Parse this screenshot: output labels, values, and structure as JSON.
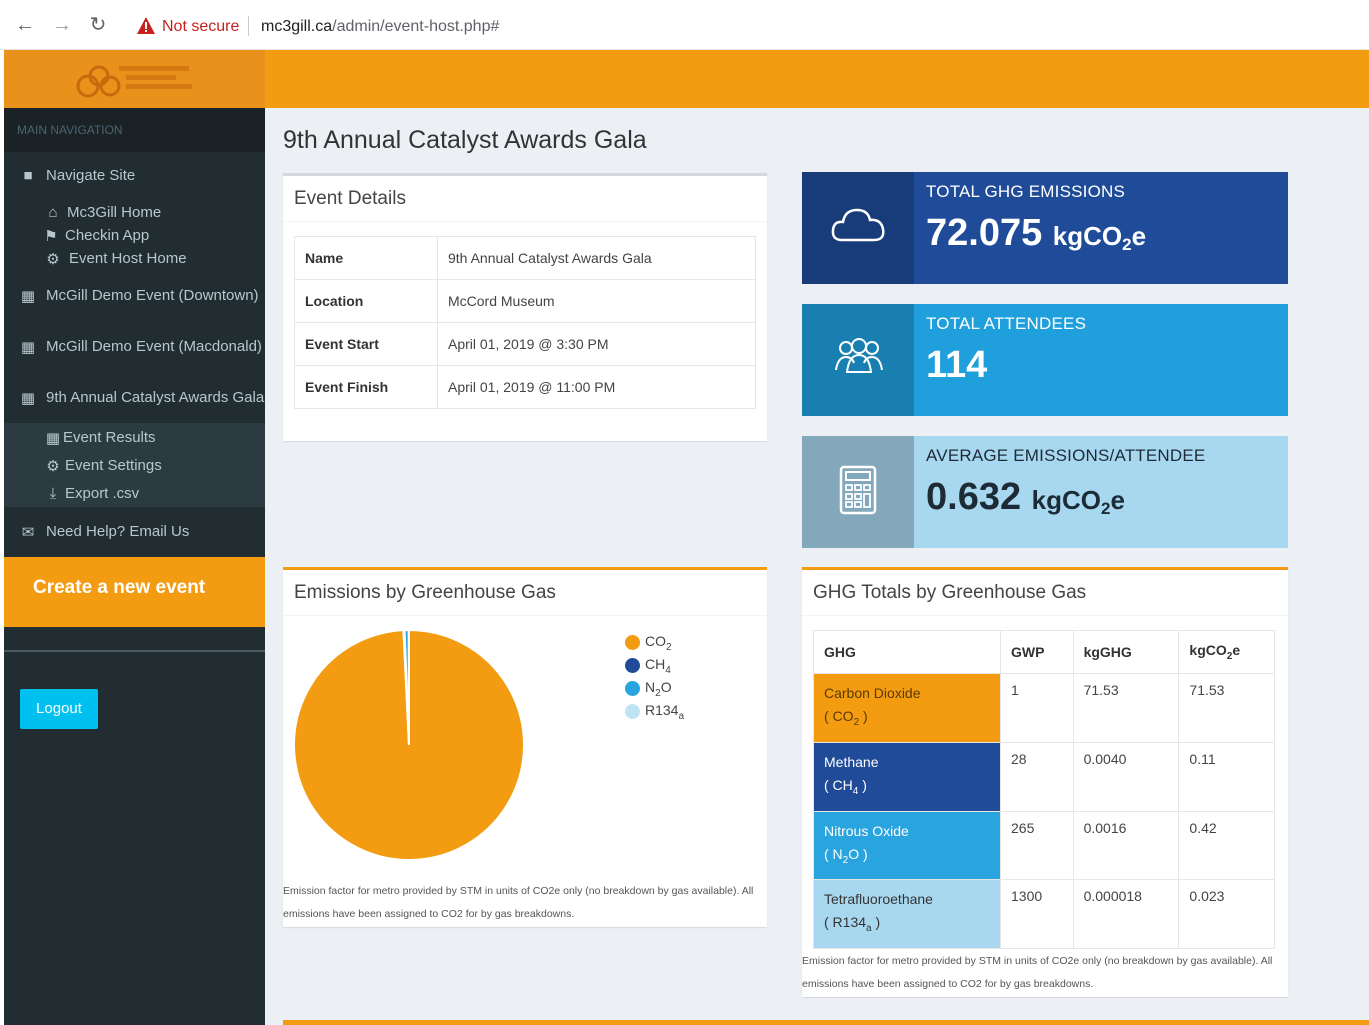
{
  "browser": {
    "security_label": "Not secure",
    "url_host": "mc3gill.ca",
    "url_path": "/admin/event-host.php#"
  },
  "sidebar": {
    "logo_text": "McGill Carbon Calculator",
    "header": "MAIN NAVIGATION",
    "navigate_site": "Navigate Site",
    "links": [
      "Mc3Gill Home",
      "Checkin App",
      "Event Host Home"
    ],
    "events": [
      "McGill Demo Event (Downtown)",
      "McGill Demo Event (Macdonald)",
      "9th Annual Catalyst Awards Gala"
    ],
    "event_sub": [
      "Event Results",
      "Event Settings",
      "Export .csv"
    ],
    "help": "Need Help? Email Us",
    "create": "Create a new event",
    "logout": "Logout"
  },
  "page": {
    "title": "9th Annual Catalyst Awards Gala"
  },
  "event_details": {
    "title": "Event Details",
    "rows": [
      {
        "label": "Name",
        "value": "9th Annual Catalyst Awards Gala"
      },
      {
        "label": "Location",
        "value": "McCord Museum"
      },
      {
        "label": "Event Start",
        "value": "April 01, 2019 @ 3:30 PM"
      },
      {
        "label": "Event Finish",
        "value": "April 01, 2019 @ 11:00 PM"
      }
    ]
  },
  "stats": {
    "ghg_label": "TOTAL GHG EMISSIONS",
    "ghg_value": "72.075",
    "unit_prefix": "kgCO",
    "unit_sub": "2",
    "unit_suffix": "e",
    "attendees_label": "TOTAL ATTENDEES",
    "attendees_value": "114",
    "avg_label": "AVERAGE EMISSIONS/ATTENDEE",
    "avg_value": "0.632"
  },
  "colors": {
    "orange": "#f39c12",
    "navy": "#1f4b99",
    "blue": "#2aa4de",
    "lightblue": "#a8d8f0"
  },
  "chart_data": {
    "type": "pie",
    "title": "Emissions by Greenhouse Gas",
    "series": [
      {
        "name": "CO2",
        "label_main": "CO",
        "label_sub": "2",
        "value": 71.53,
        "color": "#f39c12"
      },
      {
        "name": "CH4",
        "label_main": "CH",
        "label_sub": "4",
        "value": 0.11,
        "color": "#1f4b99"
      },
      {
        "name": "N2O",
        "label_main": "N",
        "label_sub": "2",
        "label_tail": "O",
        "value": 0.42,
        "color": "#2aa4de"
      },
      {
        "name": "R134a",
        "label_main": "R134",
        "label_sub": "a",
        "value": 0.023,
        "color": "#bde3f5"
      }
    ],
    "legend_position": "top-right"
  },
  "chart_footnote": "Emission factor for metro provided by STM in units of CO2e only (no breakdown by gas available). All emissions have been assigned to CO2 for by gas breakdowns.",
  "ghg_table": {
    "title": "GHG Totals by Greenhouse Gas",
    "headers": [
      "GHG",
      "GWP",
      "kgGHG",
      "kgCO2e"
    ],
    "rows": [
      {
        "name": "Carbon Dioxide",
        "formula_main": "CO",
        "formula_sub": "2",
        "formula_tail": "",
        "gwp": "1",
        "kgghg": "71.53",
        "kgco2e": "71.53",
        "bg": "#f39c12",
        "fg": "#5a3b00"
      },
      {
        "name": "Methane",
        "formula_main": "CH",
        "formula_sub": "4",
        "formula_tail": "",
        "gwp": "28",
        "kgghg": "0.0040",
        "kgco2e": "0.11",
        "bg": "#1f4b99",
        "fg": "#ffffff"
      },
      {
        "name": "Nitrous Oxide",
        "formula_main": "N",
        "formula_sub": "2",
        "formula_tail": "O",
        "gwp": "265",
        "kgghg": "0.0016",
        "kgco2e": "0.42",
        "bg": "#2aa4de",
        "fg": "#ffffff"
      },
      {
        "name": "Tetrafluoroethane",
        "formula_main": "R134",
        "formula_sub": "a",
        "formula_tail": "",
        "gwp": "1300",
        "kgghg": "0.000018",
        "kgco2e": "0.023",
        "bg": "#a8d8f0",
        "fg": "#333333"
      }
    ],
    "footnote": "Emission factor for metro provided by STM in units of CO2e only (no breakdown by gas available). All emissions have been assigned to CO2 for by gas breakdowns."
  }
}
